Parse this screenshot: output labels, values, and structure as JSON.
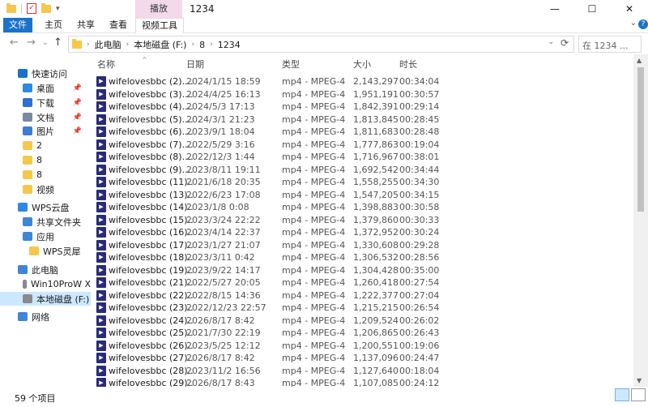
{
  "window": {
    "title": "1234",
    "context_tab": "播放",
    "controls": {
      "minimize": "—",
      "maximize": "☐",
      "close": "✕"
    }
  },
  "ribbon": {
    "tabs": [
      "文件",
      "主页",
      "共享",
      "查看",
      "视频工具"
    ]
  },
  "address": {
    "crumbs": [
      "此电脑",
      "本地磁盘 (F:)",
      "8",
      "1234"
    ],
    "search_placeholder": "在 1234 ..."
  },
  "nav": {
    "items": [
      {
        "label": "快速访问",
        "icon": "star-icon",
        "color": "#1a73c8",
        "pinned": false,
        "indent": 1
      },
      {
        "label": "桌面",
        "icon": "desktop-icon",
        "color": "#2d8ae0",
        "pinned": true,
        "indent": 2
      },
      {
        "label": "下载",
        "icon": "download-icon",
        "color": "#2d6fd6",
        "pinned": true,
        "indent": 2
      },
      {
        "label": "文档",
        "icon": "document-icon",
        "color": "#7a8aa0",
        "pinned": true,
        "indent": 2
      },
      {
        "label": "图片",
        "icon": "pictures-icon",
        "color": "#3c7fd0",
        "pinned": true,
        "indent": 2
      },
      {
        "label": "2",
        "icon": "folder-icon",
        "color": "#f5c84b",
        "pinned": false,
        "indent": 2
      },
      {
        "label": "8",
        "icon": "folder-icon",
        "color": "#f5c84b",
        "pinned": false,
        "indent": 2
      },
      {
        "label": "8",
        "icon": "folder-icon",
        "color": "#f5c84b",
        "pinned": false,
        "indent": 2
      },
      {
        "label": "视频",
        "icon": "folder-icon",
        "color": "#f5c84b",
        "pinned": false,
        "indent": 2
      },
      {
        "label": "WPS云盘",
        "icon": "cloud-icon",
        "color": "#2d8ae0",
        "pinned": false,
        "indent": 1
      },
      {
        "label": "共享文件夹",
        "icon": "share-icon",
        "color": "#3d86d8",
        "pinned": false,
        "indent": 2
      },
      {
        "label": "应用",
        "icon": "apps-icon",
        "color": "#3d86d8",
        "pinned": false,
        "indent": 2
      },
      {
        "label": "WPS灵犀",
        "icon": "folder-icon",
        "color": "#f5c84b",
        "pinned": false,
        "indent": 3
      },
      {
        "label": "此电脑",
        "icon": "computer-icon",
        "color": "#3d86d8",
        "pinned": false,
        "indent": 1
      },
      {
        "label": "Win10ProW X",
        "icon": "drive-icon",
        "color": "#8a8a8a",
        "pinned": false,
        "indent": 2
      },
      {
        "label": "本地磁盘 (F:)",
        "icon": "drive-icon",
        "color": "#8a8a8a",
        "pinned": false,
        "indent": 2,
        "selected": true
      },
      {
        "label": "网络",
        "icon": "network-icon",
        "color": "#3d86d8",
        "pinned": false,
        "indent": 1
      }
    ]
  },
  "columns": [
    "名称",
    "日期",
    "类型",
    "大小",
    "时长"
  ],
  "files": [
    {
      "name": "wifelovesbbc (2)....",
      "date": "2024/1/15 18:59",
      "type": "mp4 - MPEG-4 ...",
      "size": "2,143,297...",
      "duration": "00:34:04"
    },
    {
      "name": "wifelovesbbc (3)....",
      "date": "2024/4/25 16:13",
      "type": "mp4 - MPEG-4 ...",
      "size": "1,951,191...",
      "duration": "00:30:57"
    },
    {
      "name": "wifelovesbbc (4)....",
      "date": "2024/5/3 17:13",
      "type": "mp4 - MPEG-4 ...",
      "size": "1,842,391...",
      "duration": "00:29:14"
    },
    {
      "name": "wifelovesbbc (5)....",
      "date": "2024/3/1 21:23",
      "type": "mp4 - MPEG-4 ...",
      "size": "1,813,845...",
      "duration": "00:28:45"
    },
    {
      "name": "wifelovesbbc (6)....",
      "date": "2023/9/1 18:04",
      "type": "mp4 - MPEG-4 ...",
      "size": "1,811,683...",
      "duration": "00:28:48"
    },
    {
      "name": "wifelovesbbc (7)....",
      "date": "2022/5/29 3:16",
      "type": "mp4 - MPEG-4 ...",
      "size": "1,777,863...",
      "duration": "00:19:04"
    },
    {
      "name": "wifelovesbbc (8)....",
      "date": "2022/12/3 1:44",
      "type": "mp4 - MPEG-4 ...",
      "size": "1,716,967...",
      "duration": "00:38:01"
    },
    {
      "name": "wifelovesbbc (9)....",
      "date": "2023/8/11 19:11",
      "type": "mp4 - MPEG-4 ...",
      "size": "1,692,542...",
      "duration": "00:34:44"
    },
    {
      "name": "wifelovesbbc (11)...",
      "date": "2021/6/18 20:35",
      "type": "mp4 - MPEG-4 ...",
      "size": "1,558,255...",
      "duration": "00:34:30"
    },
    {
      "name": "wifelovesbbc (13)...",
      "date": "2022/6/23 17:08",
      "type": "mp4 - MPEG-4 ...",
      "size": "1,547,205...",
      "duration": "00:34:15"
    },
    {
      "name": "wifelovesbbc (14)...",
      "date": "2023/1/8 0:08",
      "type": "mp4 - MPEG-4 ...",
      "size": "1,398,883...",
      "duration": "00:30:58"
    },
    {
      "name": "wifelovesbbc (15)...",
      "date": "2023/3/24 22:22",
      "type": "mp4 - MPEG-4 ...",
      "size": "1,379,860...",
      "duration": "00:30:33"
    },
    {
      "name": "wifelovesbbc (16)...",
      "date": "2023/4/14 22:37",
      "type": "mp4 - MPEG-4 ...",
      "size": "1,372,952...",
      "duration": "00:30:24"
    },
    {
      "name": "wifelovesbbc (17)...",
      "date": "2023/1/27 21:07",
      "type": "mp4 - MPEG-4 ...",
      "size": "1,330,608...",
      "duration": "00:29:28"
    },
    {
      "name": "wifelovesbbc (18)...",
      "date": "2023/3/11 0:42",
      "type": "mp4 - MPEG-4 ...",
      "size": "1,306,532...",
      "duration": "00:28:56"
    },
    {
      "name": "wifelovesbbc (19)...",
      "date": "2023/9/22 14:17",
      "type": "mp4 - MPEG-4 ...",
      "size": "1,304,428...",
      "duration": "00:35:00"
    },
    {
      "name": "wifelovesbbc (21)...",
      "date": "2022/5/27 20:05",
      "type": "mp4 - MPEG-4 ...",
      "size": "1,260,418...",
      "duration": "00:27:54"
    },
    {
      "name": "wifelovesbbc (22)...",
      "date": "2022/8/15 14:36",
      "type": "mp4 - MPEG-4 ...",
      "size": "1,222,377...",
      "duration": "00:27:04"
    },
    {
      "name": "wifelovesbbc (23)...",
      "date": "2022/12/23 22:57",
      "type": "mp4 - MPEG-4 ...",
      "size": "1,215,215...",
      "duration": "00:26:54"
    },
    {
      "name": "wifelovesbbc (24)...",
      "date": "2026/8/17 8:42",
      "type": "mp4 - MPEG-4 ...",
      "size": "1,209,524...",
      "duration": "00:26:02"
    },
    {
      "name": "wifelovesbbc (25)...",
      "date": "2021/7/30 22:19",
      "type": "mp4 - MPEG-4 ...",
      "size": "1,206,865...",
      "duration": "00:26:43"
    },
    {
      "name": "wifelovesbbc (26)...",
      "date": "2023/5/25 12:12",
      "type": "mp4 - MPEG-4 ...",
      "size": "1,200,551...",
      "duration": "00:19:06"
    },
    {
      "name": "wifelovesbbc (27)...",
      "date": "2026/8/17 8:42",
      "type": "mp4 - MPEG-4 ...",
      "size": "1,137,096...",
      "duration": "00:24:47"
    },
    {
      "name": "wifelovesbbc (28)...",
      "date": "2023/11/2 16:56",
      "type": "mp4 - MPEG-4 ...",
      "size": "1,127,640...",
      "duration": "00:18:04"
    },
    {
      "name": "wifelovesbbc (29)...",
      "date": "2026/8/17 8:43",
      "type": "mp4 - MPEG-4 ...",
      "size": "1,107,085...",
      "duration": "00:24:12"
    }
  ],
  "status": {
    "count": "59 个项目"
  }
}
